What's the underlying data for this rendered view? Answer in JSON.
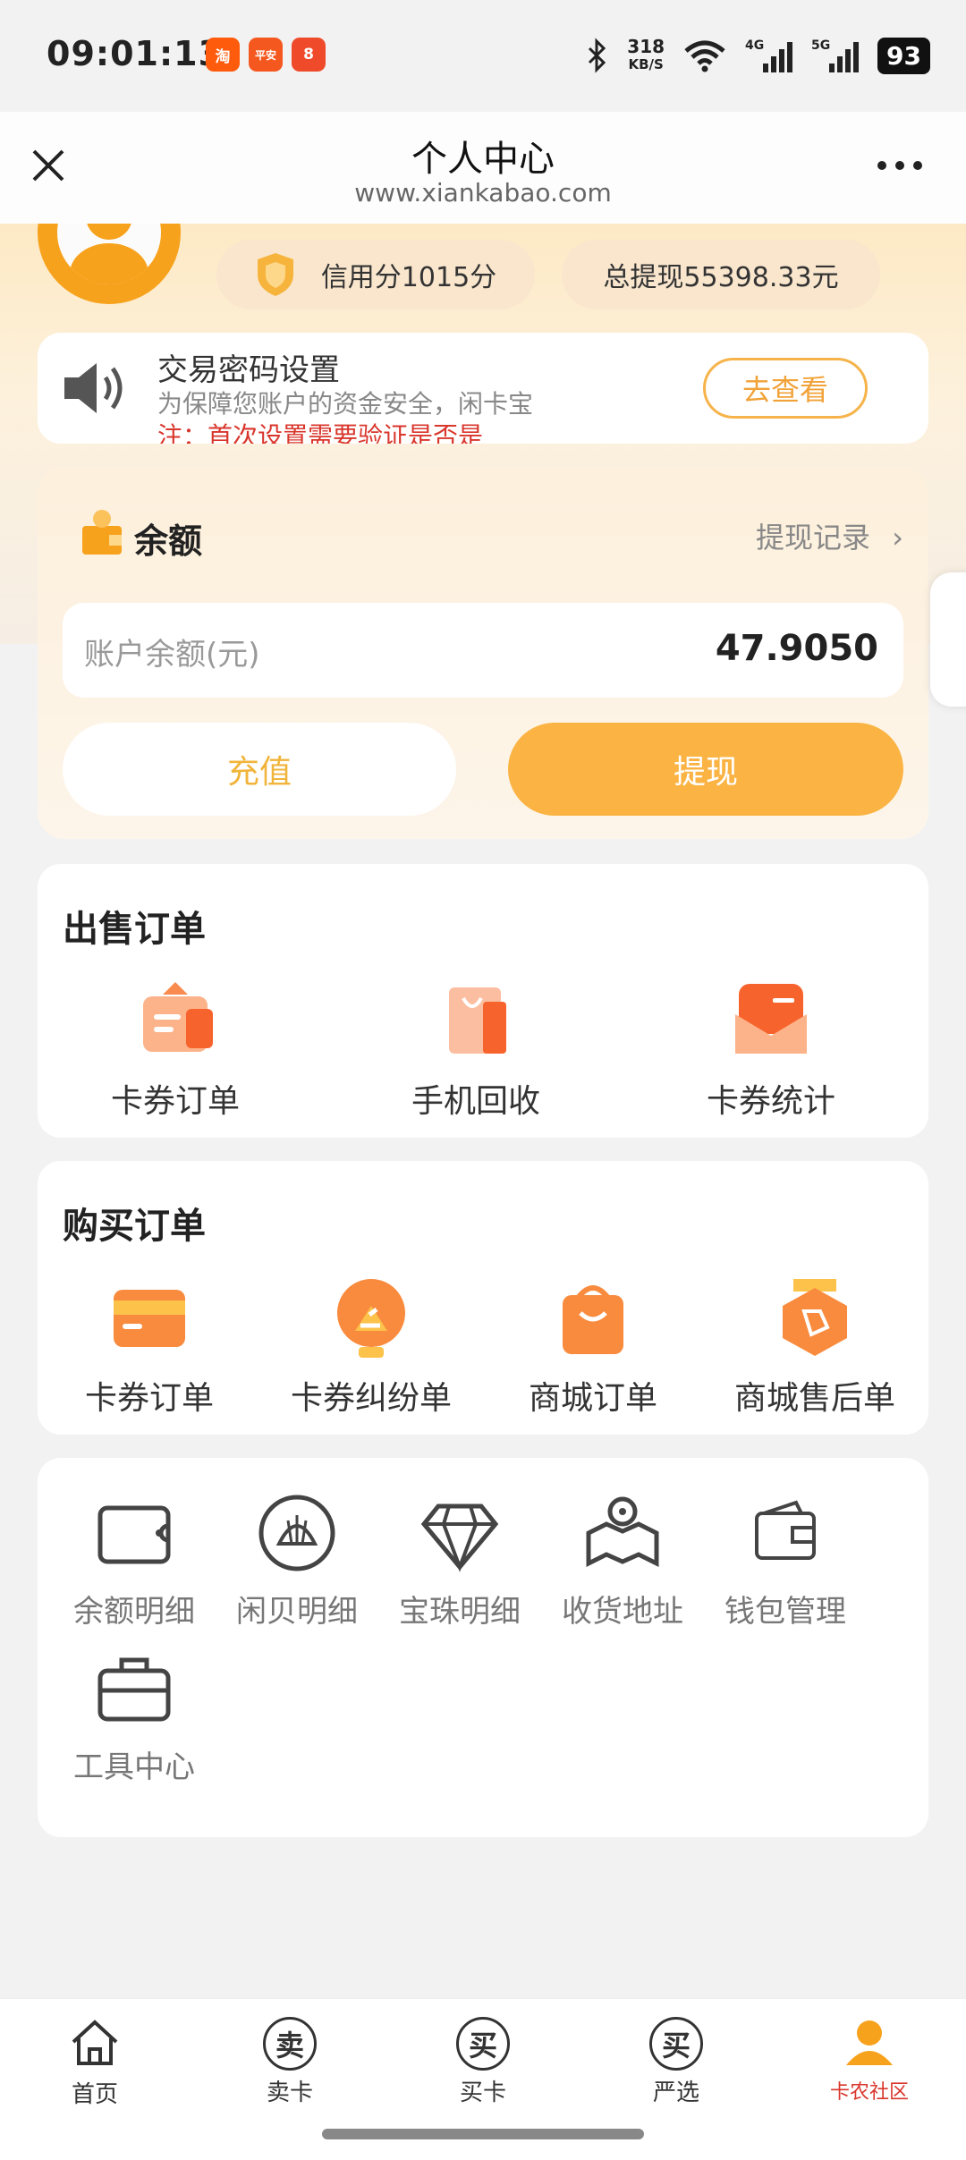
{
  "status_bar": {
    "time": "09:01:13",
    "net_speed": "318",
    "net_unit": "KB/S",
    "battery": "93",
    "apps": [
      {
        "char": "淘",
        "color": "#ff5b0c"
      },
      {
        "char": "平安",
        "color": "#f5581f"
      },
      {
        "char": "8",
        "color": "#ef4b2a"
      }
    ]
  },
  "header": {
    "title": "个人中心",
    "domain": "www.xiankabao.com"
  },
  "profile": {
    "credit_score": "信用分1015分",
    "total_withdraw": "总提现55398.33元"
  },
  "notice": {
    "title": "交易密码设置",
    "desc": "为保障您账户的资金安全，闲卡宝",
    "note": "注：首次设置需要验证是否是",
    "button": "去查看"
  },
  "balance": {
    "title": "余额",
    "record_link": "提现记录",
    "label": "账户余额(元)",
    "value": "47.9050",
    "recharge": "充值",
    "withdraw": "提现"
  },
  "sell_orders": {
    "title": "出售订单",
    "items": [
      "卡券订单",
      "手机回收",
      "卡券统计"
    ]
  },
  "buy_orders": {
    "title": "购买订单",
    "items": [
      "卡券订单",
      "卡券纠纷单",
      "商城订单",
      "商城售后单"
    ]
  },
  "tools": {
    "items": [
      "余额明细",
      "闲贝明细",
      "宝珠明细",
      "收货地址",
      "钱包管理",
      "工具中心"
    ]
  },
  "bottom_nav": {
    "items": [
      "首页",
      "卖卡",
      "买卡",
      "严选"
    ],
    "chars": [
      "卖",
      "买",
      "买"
    ],
    "watermark": "卡农社区"
  },
  "colors": {
    "accent": "#fbb444",
    "orange": "#f7a21c",
    "warning_text": "#d9362c"
  }
}
